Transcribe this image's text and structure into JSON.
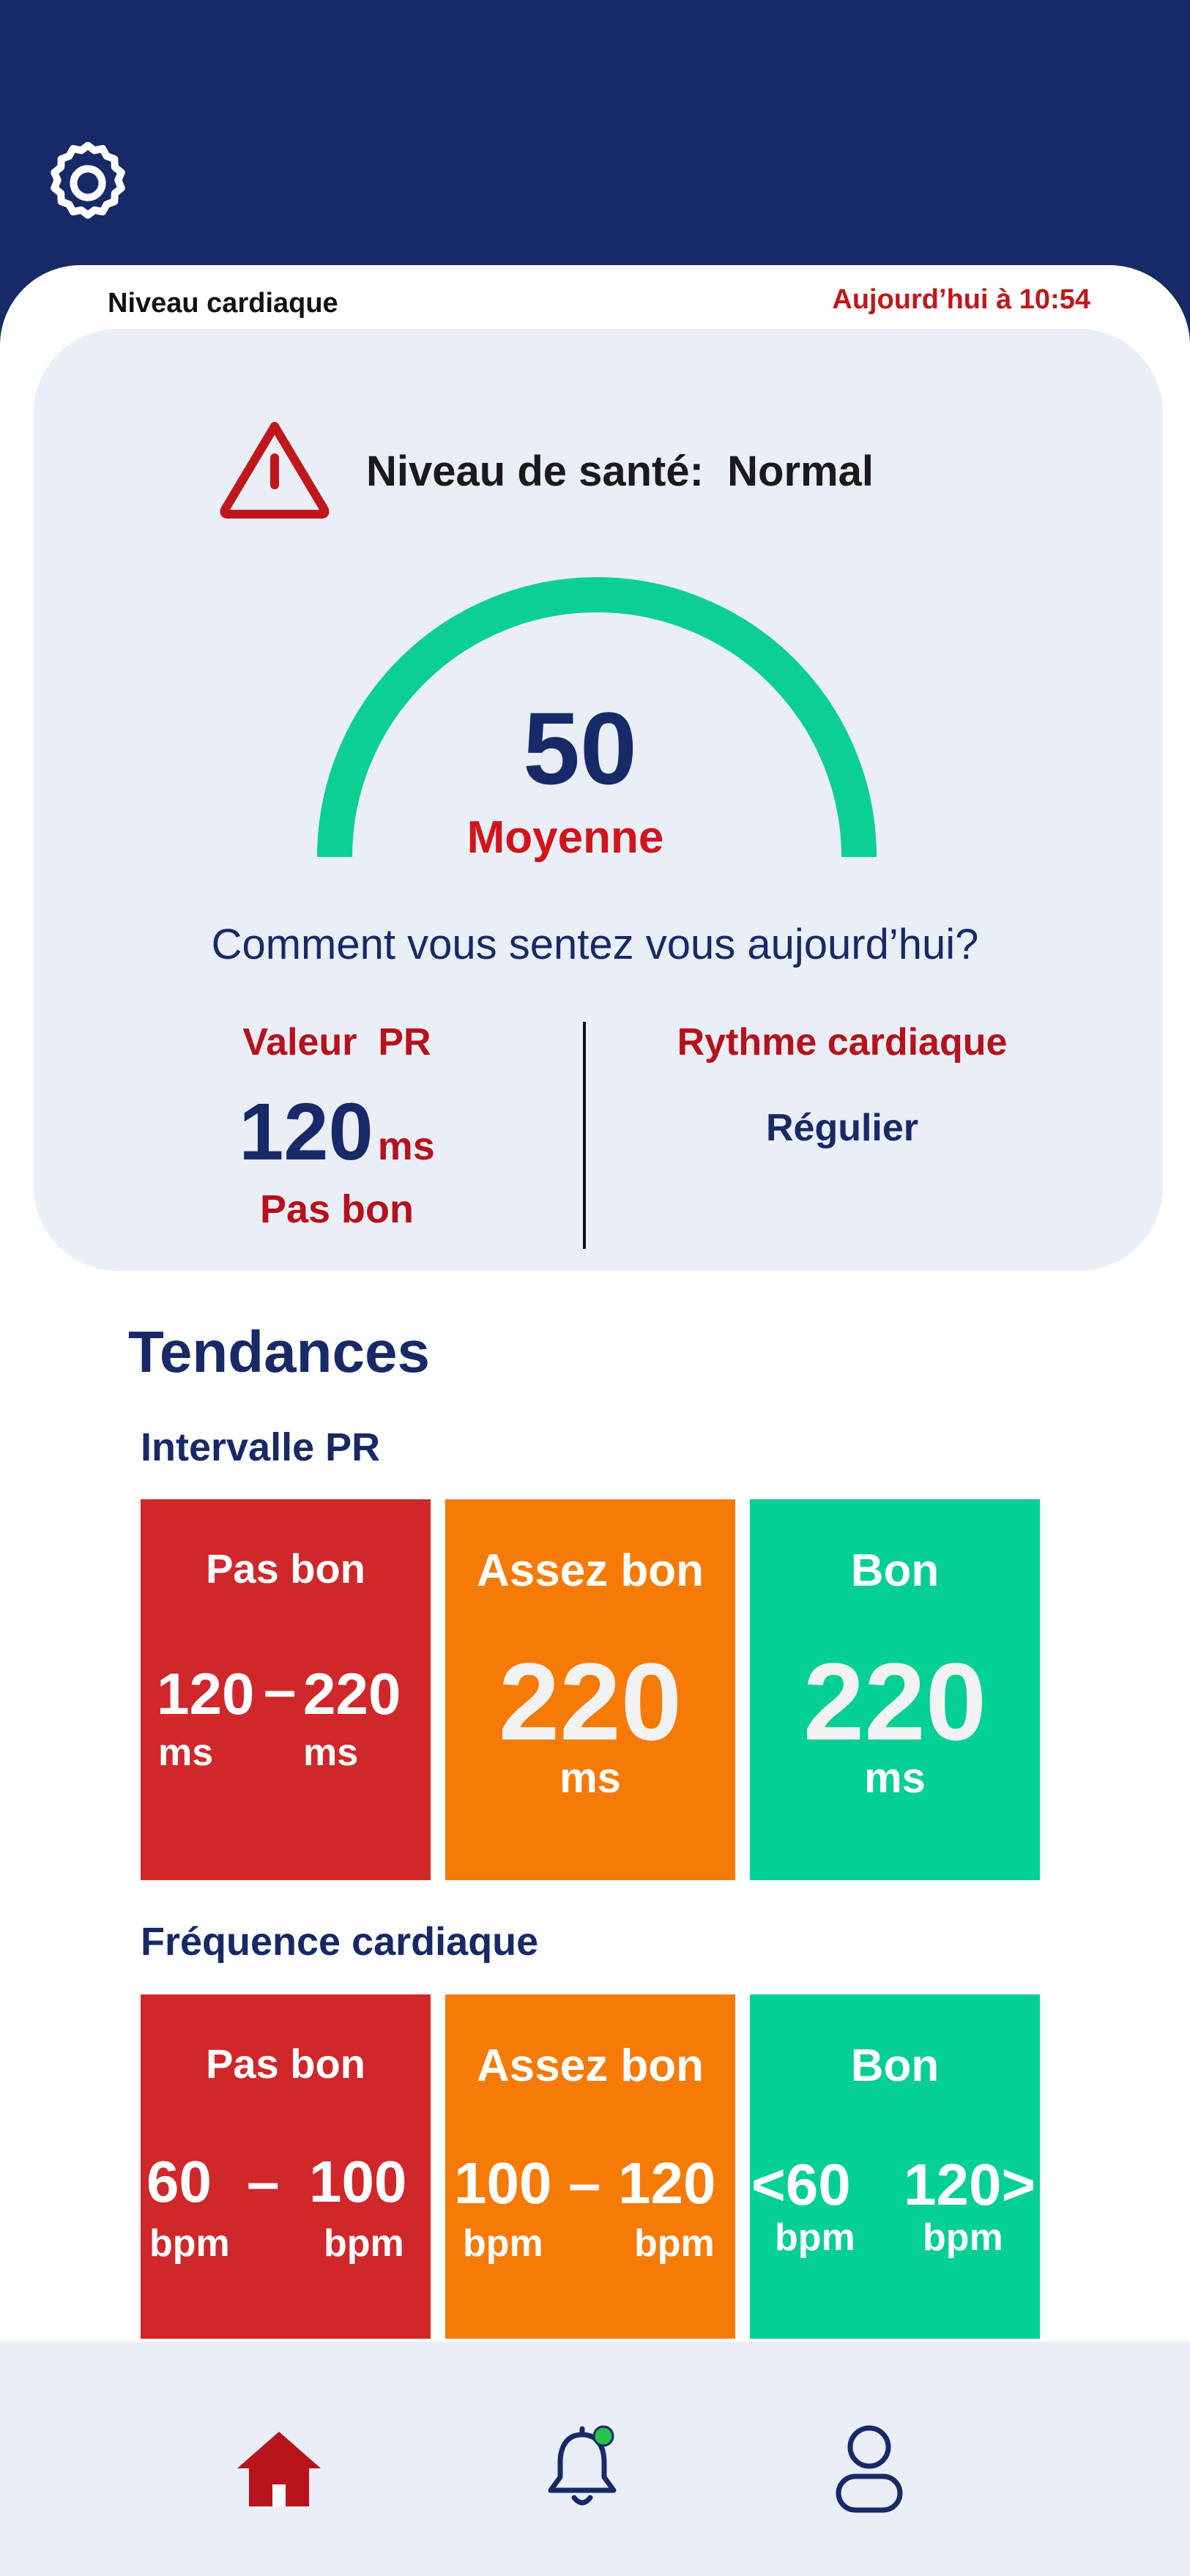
{
  "header": {
    "title": "Niveau cardiaque",
    "timestamp": "Aujourd’hui à 10:54",
    "settings_icon": "gear-icon"
  },
  "summary": {
    "health_label": "Niveau de santé:  Normal",
    "warning_icon": "warning-triangle-icon",
    "gauge": {
      "value": "50",
      "label": "Moyenne",
      "fill_fraction": 1.0,
      "color": "#0ccf94"
    },
    "question": "Comment vous sentez vous aujourd’hui?",
    "pr": {
      "title": "Valeur  PR",
      "value": "120",
      "unit": "ms",
      "status": "Pas bon"
    },
    "rhythm": {
      "title": "Rythme cardiaque",
      "value": "Régulier"
    }
  },
  "trends": {
    "title": "Tendances",
    "pr_interval": {
      "title": "Intervalle PR",
      "tiles": [
        {
          "label": "Pas bon",
          "from": "120",
          "dash": "–",
          "to": "220",
          "from_unit": "ms",
          "to_unit": "ms",
          "color": "#d0272a"
        },
        {
          "label": "Assez bon",
          "value": "220",
          "unit": "ms",
          "color": "#f67a06"
        },
        {
          "label": "Bon",
          "value": "220",
          "unit": "ms",
          "color": "#04cf94"
        }
      ]
    },
    "heart_rate": {
      "title": "Fréquence cardiaque",
      "tiles": [
        {
          "label": "Pas bon",
          "from": "60",
          "dash": "–",
          "to": "100",
          "from_unit": "bpm",
          "to_unit": "bpm",
          "color": "#d0272a"
        },
        {
          "label": "Assez bon",
          "from": "100",
          "dash": "–",
          "to": "120",
          "from_unit": "bpm",
          "to_unit": "bpm",
          "color": "#f67a06"
        },
        {
          "label": "Bon",
          "from": "<60",
          "to": "120>",
          "from_unit": "bpm",
          "to_unit": "bpm",
          "color": "#04cf94"
        }
      ]
    }
  },
  "nav": {
    "items": [
      {
        "icon": "home-icon",
        "active": true
      },
      {
        "icon": "bell-icon",
        "badge": true
      },
      {
        "icon": "user-icon",
        "active": false
      }
    ]
  },
  "colors": {
    "navy": "#182968",
    "red": "#c0171b",
    "card_bg": "#e9eef7"
  }
}
